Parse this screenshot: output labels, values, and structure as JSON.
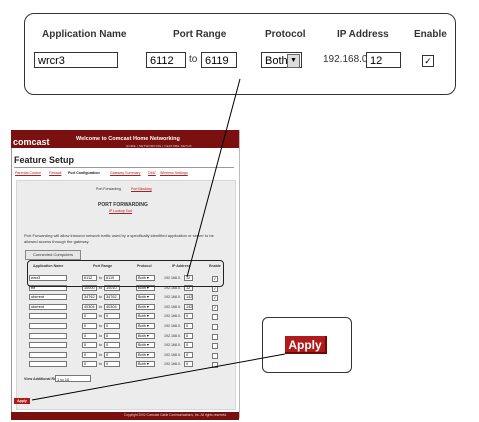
{
  "zoom": {
    "headers": {
      "app": "Application Name",
      "port": "Port Range",
      "protocol": "Protocol",
      "ip": "IP Address",
      "enable": "Enable"
    },
    "row": {
      "app": "wrcr3",
      "port_from": "6112",
      "to": "to",
      "port_to": "6119",
      "protocol": "Both",
      "ip_prefix": "192.168.0.",
      "ip_last": "12",
      "enabled": "✓"
    }
  },
  "apply_label": "Apply",
  "page": {
    "logo": "comcast",
    "welcome": "Welcome to Comcast Home Networking",
    "crumb": "HOME | NETWORKING | FEATURE SETUP",
    "title": "Feature Setup",
    "tabs": [
      "Parental Control",
      "Firewall",
      "Port Configuration",
      "Gateway Summary",
      "DMZ",
      "Wireless Settings"
    ],
    "subtabs": [
      "Port Forwarding",
      "Port Blocking"
    ],
    "section_title": "PORT FORWARDING",
    "ip_link": "IP Lookup Tool",
    "description": "Port Forwarding will allow inbound network traffic used by a specifically identified application or server to be allowed access through the gateway.",
    "connected_button": "Connected Computers",
    "columns": [
      "Application Name",
      "Port Range",
      "Protocol",
      "IP Address",
      "Enable"
    ],
    "rows": [
      {
        "name": "wrcr3",
        "from": "6112",
        "to": "6119",
        "proto": "Both",
        "ip": "12",
        "on": "✓"
      },
      {
        "name": "bit",
        "from": "10000",
        "to": "10010",
        "proto": "Both",
        "ip": "12",
        "on": "✓"
      },
      {
        "name": "utorrent",
        "from": "34762",
        "to": "34762",
        "proto": "Both",
        "ip": "142",
        "on": "✓"
      },
      {
        "name": "utorrent",
        "from": "40304",
        "to": "40304",
        "proto": "Both",
        "ip": "142",
        "on": "✓"
      },
      {
        "name": "",
        "from": "0",
        "to": "0",
        "proto": "Both",
        "ip": "0",
        "on": ""
      },
      {
        "name": "",
        "from": "0",
        "to": "0",
        "proto": "Both",
        "ip": "0",
        "on": ""
      },
      {
        "name": "",
        "from": "0",
        "to": "0",
        "proto": "Both",
        "ip": "0",
        "on": ""
      },
      {
        "name": "",
        "from": "0",
        "to": "0",
        "proto": "Both",
        "ip": "0",
        "on": ""
      },
      {
        "name": "",
        "from": "0",
        "to": "0",
        "proto": "Both",
        "ip": "0",
        "on": ""
      },
      {
        "name": "",
        "from": "0",
        "to": "0",
        "proto": "Both",
        "ip": "0",
        "on": ""
      }
    ],
    "ip_prefix": "192.168.0.",
    "to_label": "to",
    "view_label": "View Additional Rules:",
    "view_value": "1 to 10",
    "apply_small": "Apply",
    "copyright": "Copyright 2002 Comcast Cable Communications, Inc. All rights reserved."
  }
}
